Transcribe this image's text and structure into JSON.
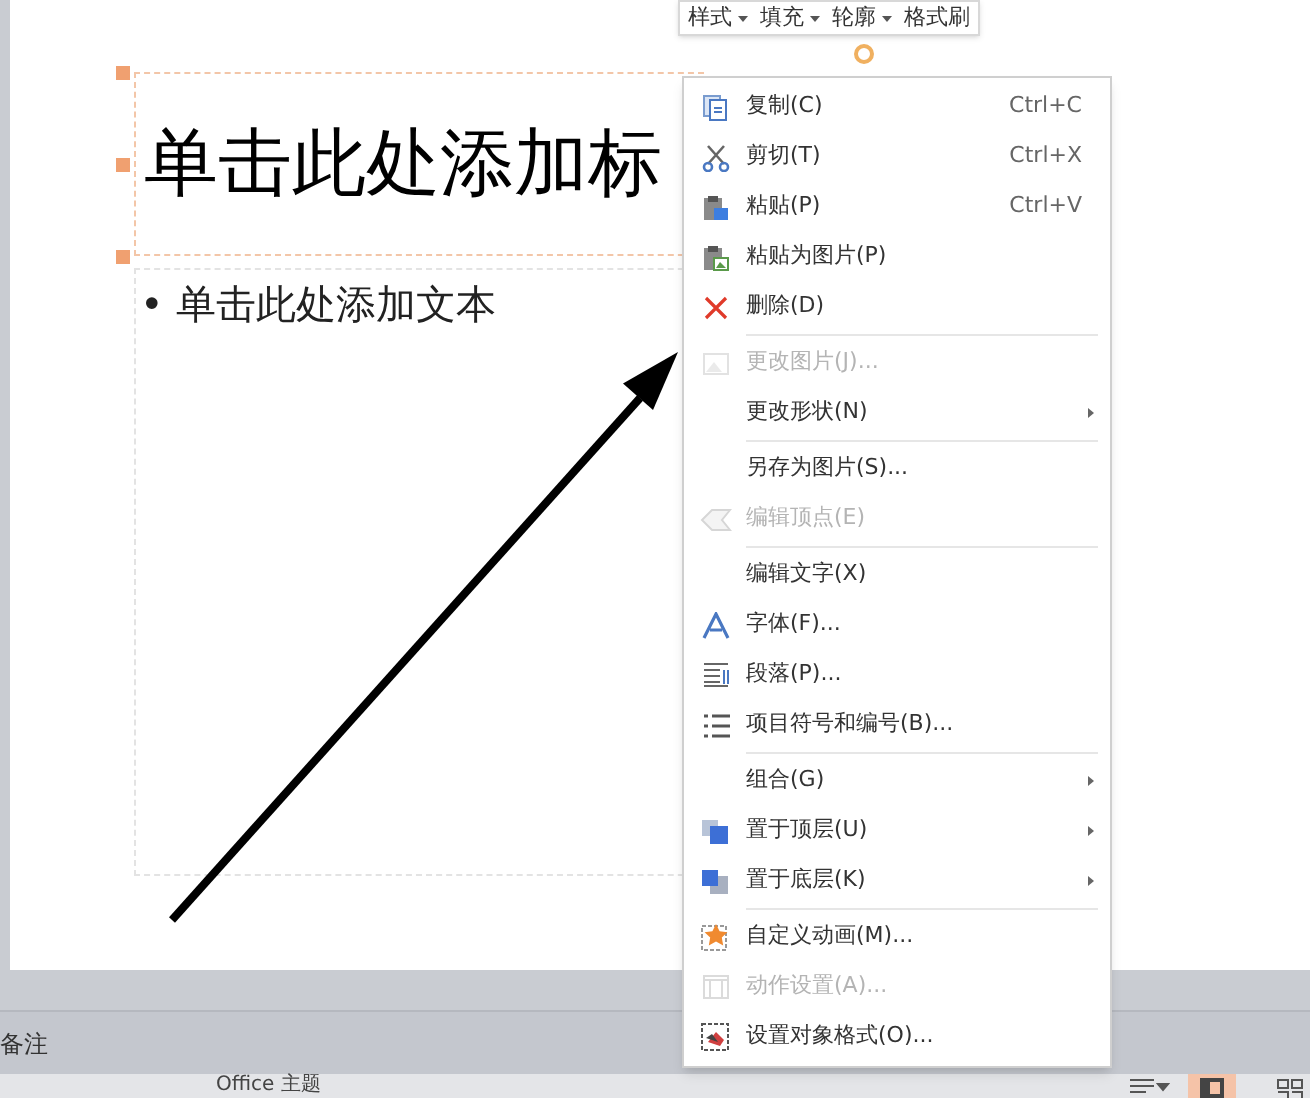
{
  "toolbar": [
    {
      "label": "样式",
      "kind": "dropdown"
    },
    {
      "label": "填充",
      "kind": "dropdown"
    },
    {
      "label": "轮廓",
      "kind": "dropdown"
    },
    {
      "label": "格式刷",
      "kind": "button"
    }
  ],
  "slide": {
    "title": "单击此处添加标",
    "body": "• 单击此处添加文本"
  },
  "context_menu": [
    {
      "kind": "item",
      "label": "复制(C)",
      "shortcut": "Ctrl+C",
      "disabled": false,
      "submenu": false
    },
    {
      "kind": "item",
      "label": "剪切(T)",
      "shortcut": "Ctrl+X",
      "disabled": false,
      "submenu": false
    },
    {
      "kind": "item",
      "label": "粘贴(P)",
      "shortcut": "Ctrl+V",
      "disabled": false,
      "submenu": false
    },
    {
      "kind": "item",
      "label": "粘贴为图片(P)",
      "disabled": false,
      "submenu": false
    },
    {
      "kind": "item",
      "label": "删除(D)",
      "disabled": false,
      "submenu": false
    },
    {
      "kind": "separator"
    },
    {
      "kind": "item",
      "label": "更改图片(J)...",
      "disabled": true,
      "submenu": false
    },
    {
      "kind": "item",
      "label": "更改形状(N)",
      "disabled": false,
      "submenu": true
    },
    {
      "kind": "separator"
    },
    {
      "kind": "item",
      "label": "另存为图片(S)...",
      "disabled": false,
      "submenu": false
    },
    {
      "kind": "item",
      "label": "编辑顶点(E)",
      "disabled": true,
      "submenu": false
    },
    {
      "kind": "separator"
    },
    {
      "kind": "item",
      "label": "编辑文字(X)",
      "disabled": false,
      "submenu": false
    },
    {
      "kind": "item",
      "label": "字体(F)...",
      "disabled": false,
      "submenu": false
    },
    {
      "kind": "item",
      "label": "段落(P)...",
      "disabled": false,
      "submenu": false
    },
    {
      "kind": "item",
      "label": "项目符号和编号(B)...",
      "disabled": false,
      "submenu": false
    },
    {
      "kind": "separator"
    },
    {
      "kind": "item",
      "label": "组合(G)",
      "disabled": false,
      "submenu": true
    },
    {
      "kind": "item",
      "label": "置于顶层(U)",
      "disabled": false,
      "submenu": true
    },
    {
      "kind": "item",
      "label": "置于底层(K)",
      "disabled": false,
      "submenu": true
    },
    {
      "kind": "separator"
    },
    {
      "kind": "item",
      "label": "自定义动画(M)...",
      "disabled": false,
      "submenu": false
    },
    {
      "kind": "item",
      "label": "动作设置(A)...",
      "disabled": true,
      "submenu": false
    },
    {
      "kind": "item",
      "label": "设置对象格式(O)...",
      "disabled": false,
      "submenu": false
    }
  ],
  "notes": {
    "label": "备注"
  },
  "status_bar": {
    "theme": "Office 主题"
  }
}
